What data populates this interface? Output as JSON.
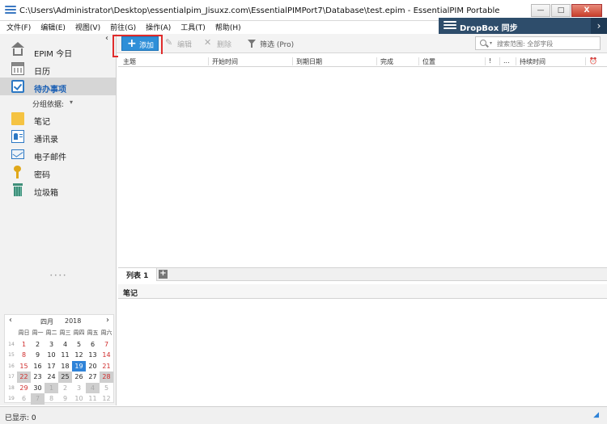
{
  "window": {
    "title": "C:\\Users\\Administrator\\Desktop\\essentialpim_Jisuxz.com\\EssentialPIMPort7\\Database\\test.epim - EssentialPIM Portable",
    "minimize": "—",
    "maximize": "□",
    "close": "X"
  },
  "menu": [
    "文件(F)",
    "编辑(E)",
    "视图(V)",
    "前往(G)",
    "操作(A)",
    "工具(T)",
    "帮助(H)"
  ],
  "dropbox": {
    "label": "DropBox 同步",
    "chevron": "›"
  },
  "sidebar": {
    "collapse": "‹",
    "items": [
      {
        "label": "EPIM 今日",
        "icon": "home-icon"
      },
      {
        "label": "日历",
        "icon": "calendar-icon"
      },
      {
        "label": "待办事项",
        "icon": "todo-icon",
        "active": true
      },
      {
        "label": "笔记",
        "icon": "note-icon"
      },
      {
        "label": "通讯录",
        "icon": "contact-icon"
      },
      {
        "label": "电子邮件",
        "icon": "mail-icon"
      },
      {
        "label": "密码",
        "icon": "key-icon"
      },
      {
        "label": "垃圾箱",
        "icon": "trash-icon"
      }
    ],
    "group_by": {
      "label": "分组依据:",
      "caret": "▾"
    }
  },
  "calendar": {
    "prev": "‹",
    "next": "›",
    "month": "四月",
    "year": "2018",
    "splitter": "• • • •",
    "day_headers": [
      "周日",
      "周一",
      "周二",
      "周三",
      "周四",
      "周五",
      "周六"
    ],
    "weeks": [
      {
        "wk": "14",
        "days": [
          "1",
          "2",
          "3",
          "4",
          "5",
          "6",
          "7"
        ]
      },
      {
        "wk": "15",
        "days": [
          "8",
          "9",
          "10",
          "11",
          "12",
          "13",
          "14"
        ]
      },
      {
        "wk": "16",
        "days": [
          "15",
          "16",
          "17",
          "18",
          "19",
          "20",
          "21"
        ]
      },
      {
        "wk": "17",
        "days": [
          "22",
          "23",
          "24",
          "25",
          "26",
          "27",
          "28"
        ]
      },
      {
        "wk": "18",
        "days": [
          "29",
          "30",
          "1",
          "2",
          "3",
          "4",
          "5"
        ]
      },
      {
        "wk": "19",
        "days": [
          "6",
          "7",
          "8",
          "9",
          "10",
          "11",
          "12"
        ]
      }
    ],
    "today": "19"
  },
  "toolbar": {
    "add": "添加",
    "add_plus": "+",
    "edit": "编辑",
    "edit_glyph": "✎",
    "delete": "删除",
    "delete_glyph": "✕",
    "filter": "筛选 (Pro)",
    "search_caret": "▾",
    "search_placeholder": "搜索范围: 全部字段"
  },
  "table": {
    "columns": [
      "主题",
      "开始时间",
      "到期日期",
      "完成",
      "位置",
      "!",
      "...",
      "持续时间",
      "⏰"
    ]
  },
  "tabs": {
    "list": "列表 1",
    "add": "+"
  },
  "notes": {
    "title": "笔记"
  },
  "status": {
    "text": "已显示: 0",
    "grip": "◢"
  }
}
